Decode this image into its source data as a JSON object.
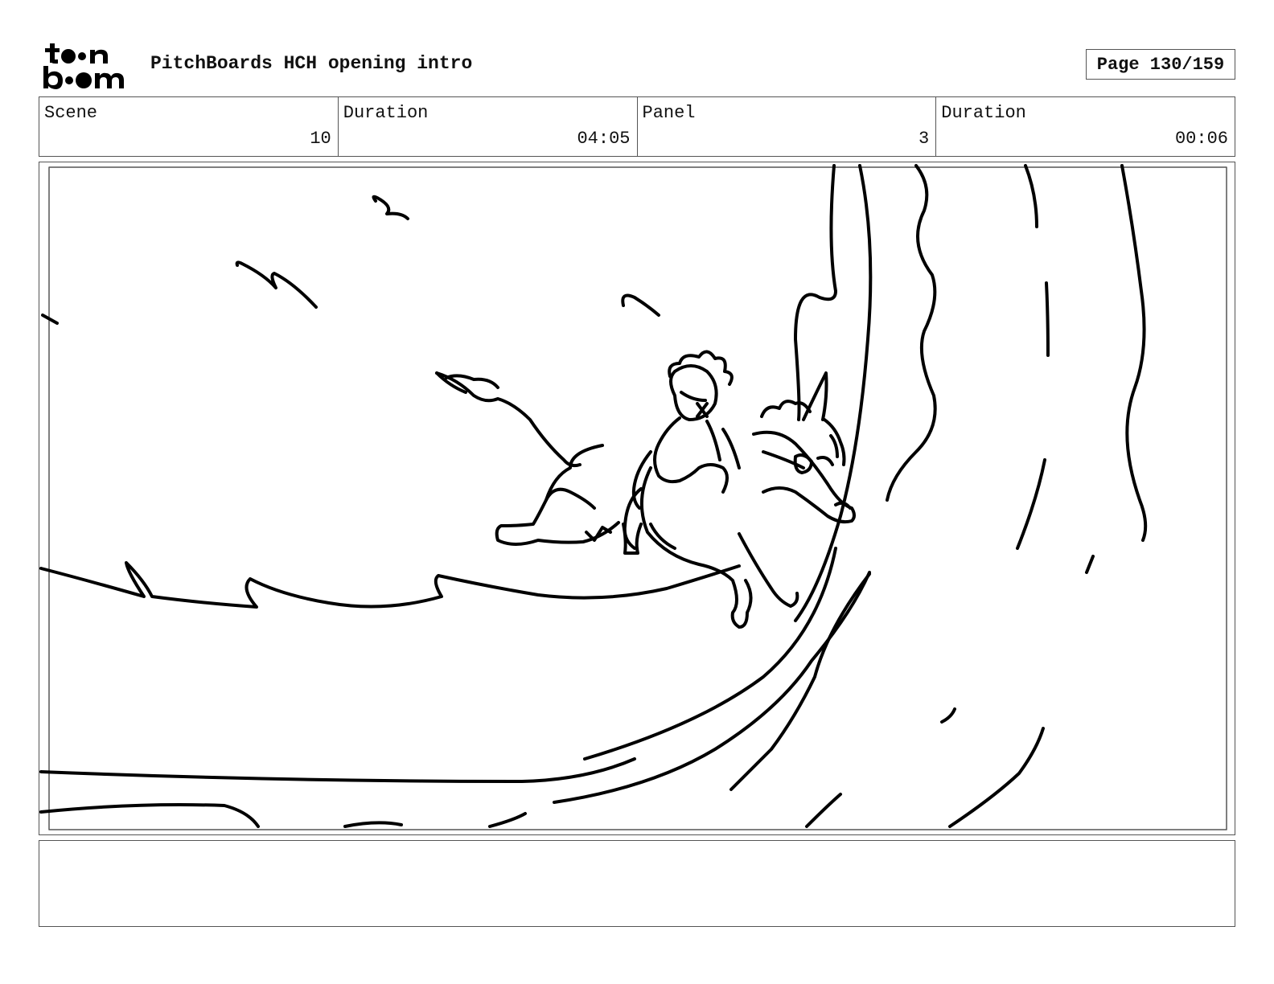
{
  "logo": {
    "name": "toon boom logo",
    "line1": "toon",
    "line2": "boom"
  },
  "header": {
    "title": "PitchBoards HCH opening intro",
    "page": "Page 130/159"
  },
  "info": [
    {
      "label": "Scene",
      "value": "10"
    },
    {
      "label": "Duration",
      "value": "04:05"
    },
    {
      "label": "Panel",
      "value": "3"
    },
    {
      "label": "Duration",
      "value": "00:06"
    }
  ],
  "panel": {
    "description": "Sketch: boy riding a unicorn surfing along a giant curling wave"
  },
  "notes": {
    "text": ""
  }
}
